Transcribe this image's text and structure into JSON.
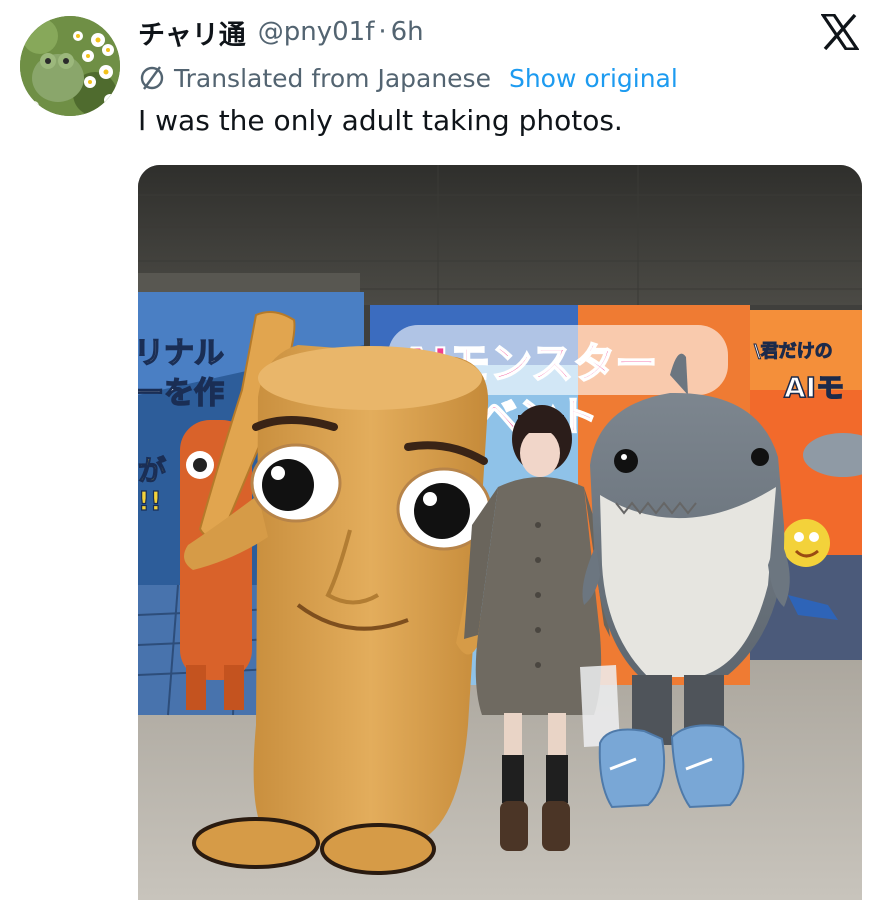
{
  "tweet": {
    "author": {
      "display_name": "チャリ通",
      "handle": "@pny01f",
      "separator": "·",
      "time": "6h"
    },
    "translation": {
      "label": "Translated from Japanese",
      "show_original": "Show original"
    },
    "text": "I was the only adult taking photos.",
    "media": {
      "banner_main": "AIモンスター",
      "banner_main_line2": "ベント",
      "banner_left_1": "リナル",
      "banner_left_2": "ーを作",
      "banner_left_3": "が",
      "banner_left_4": "!!",
      "banner_right_1": "\\君だけの",
      "banner_right_2": "AIモ"
    }
  },
  "icons": {
    "platform_logo": "x-logo-icon",
    "translate": "globe-icon"
  },
  "colors": {
    "link": "#1d9bf0",
    "secondary_text": "#536471",
    "primary_text": "#0f1419"
  }
}
